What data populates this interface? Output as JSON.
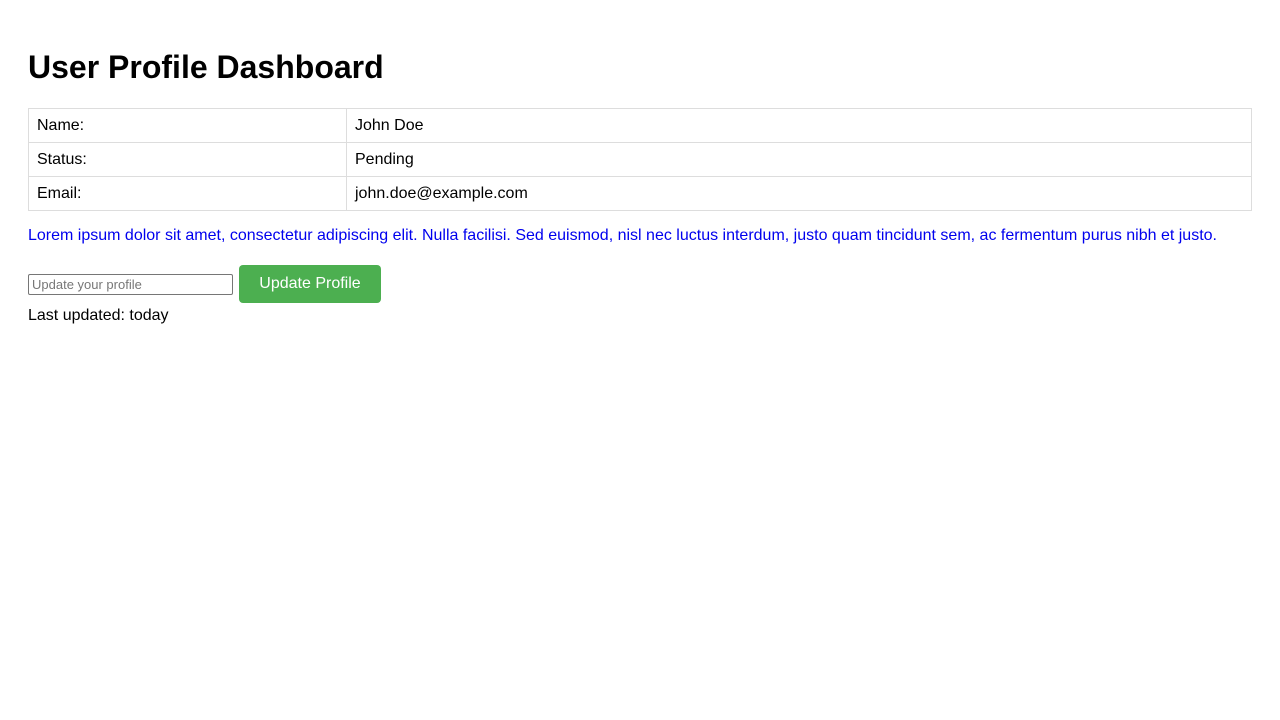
{
  "page": {
    "title": "User Profile Dashboard"
  },
  "profile": {
    "rows": [
      {
        "label": "Name:",
        "value": "John Doe"
      },
      {
        "label": "Status:",
        "value": "Pending"
      },
      {
        "label": "Email:",
        "value": "john.doe@example.com"
      }
    ]
  },
  "description": "Lorem ipsum dolor sit amet, consectetur adipiscing elit. Nulla facilisi. Sed euismod, nisl nec luctus interdum, justo quam tincidunt sem, ac fermentum purus nibh et justo.",
  "update_form": {
    "input_value": "",
    "input_placeholder": "Update your profile",
    "button_label": "Update Profile"
  },
  "last_updated": "Last updated: today",
  "colors": {
    "description_text": "#0000ee",
    "button_background": "#4caf50",
    "button_text": "#ffffff",
    "table_border": "#dddddd"
  }
}
